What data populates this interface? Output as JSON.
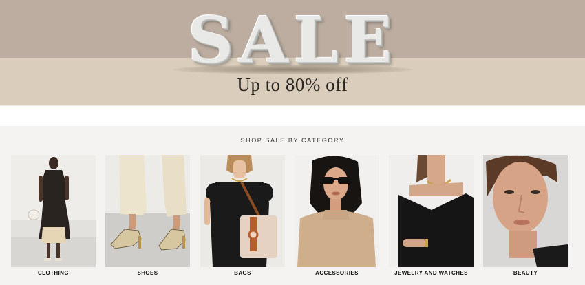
{
  "banner": {
    "headline": "SALE",
    "subheadline": "Up to 80% off"
  },
  "section": {
    "title": "SHOP SALE BY CATEGORY"
  },
  "categories": [
    {
      "label": "CLOTHING"
    },
    {
      "label": "SHOES"
    },
    {
      "label": "BAGS"
    },
    {
      "label": "ACCESSORIES"
    },
    {
      "label": "JEWELRY AND WATCHES"
    },
    {
      "label": "BEAUTY"
    }
  ],
  "colors": {
    "banner_top": "#bcada0",
    "banner_bottom": "#dacdbb",
    "section_bg": "#f4f3f1",
    "text": "#111111"
  }
}
